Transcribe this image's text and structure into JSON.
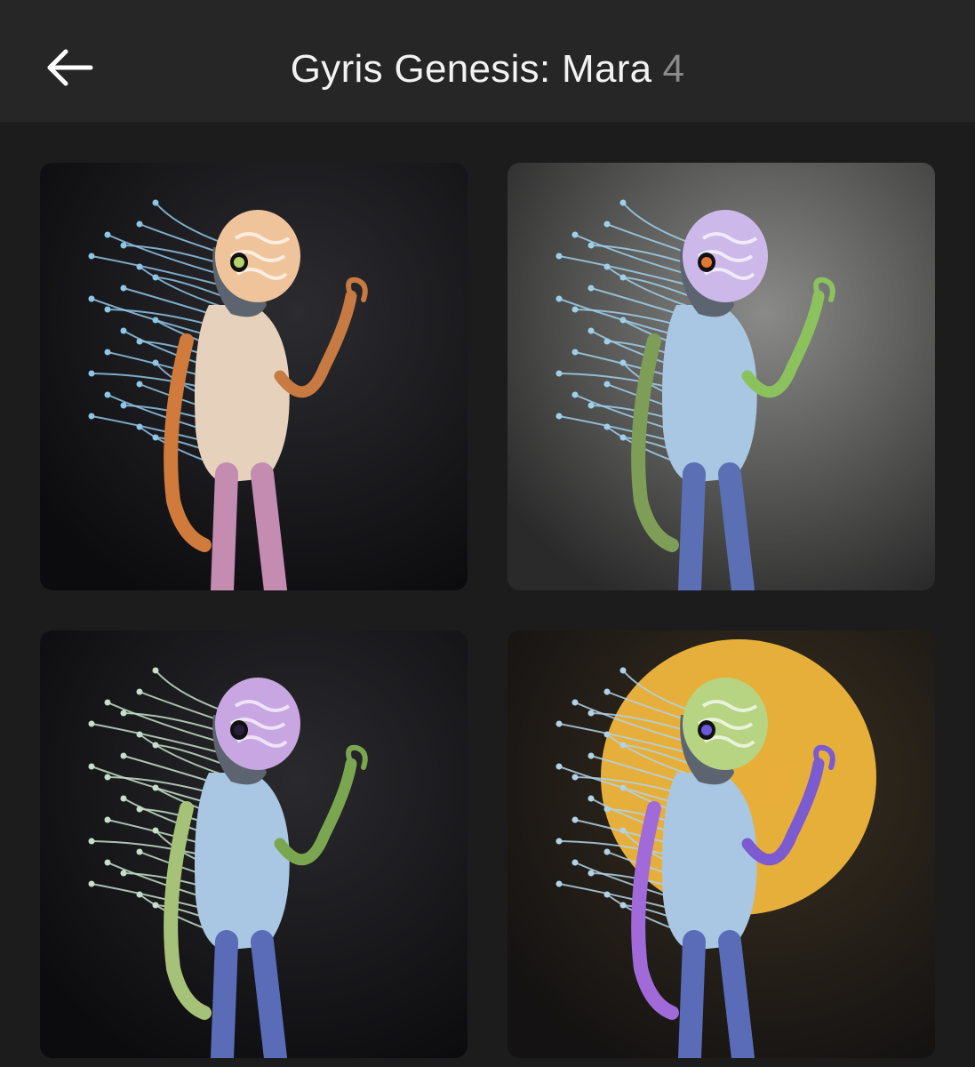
{
  "header": {
    "title": "Gyris Genesis: Mara",
    "count": "4"
  },
  "gallery": {
    "items": [
      {
        "bg": "#0c0c0f",
        "bg_glow": "#2c2c30",
        "brain": "#f0c49a",
        "body": "#e6d2bc",
        "arm_back": "#d07a3c",
        "arm_front": "#c77a42",
        "legs": "#c48cb0",
        "tendrils": "#8fc6e8",
        "eye": "#b4d36a",
        "sun": null
      },
      {
        "bg": "#2a2a2a",
        "bg_glow": "#8a8a88",
        "brain": "#cdb8ea",
        "body": "#a9c6e2",
        "arm_back": "#7e9e58",
        "arm_front": "#8cc25e",
        "legs": "#5b6fb4",
        "tendrils": "#9fd0ea",
        "eye": "#e07a30",
        "sun": null
      },
      {
        "bg": "#0c0c0f",
        "bg_glow": "#2a2a2e",
        "brain": "#c8a6e2",
        "body": "#a9c6e2",
        "arm_back": "#a6c278",
        "arm_front": "#7aa650",
        "legs": "#5a6cb8",
        "tendrils": "#c6e0c8",
        "eye": "#2a1e40",
        "sun": null
      },
      {
        "bg": "#141212",
        "bg_glow": "#3a3020",
        "brain": "#b6d482",
        "body": "#a9c6e2",
        "arm_back": "#a06ad8",
        "arm_front": "#7c5ad0",
        "legs": "#5a6cb8",
        "tendrils": "#b2d2e6",
        "eye": "#6a5ad8",
        "sun": "#f0b63c"
      }
    ]
  }
}
